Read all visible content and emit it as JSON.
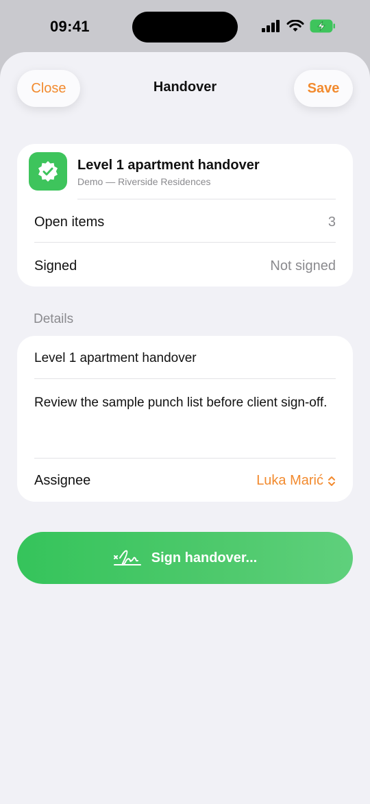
{
  "status_bar": {
    "time": "09:41",
    "icons": [
      "cellular-signal-icon",
      "wifi-icon",
      "battery-charging-icon"
    ]
  },
  "nav": {
    "close_label": "Close",
    "title": "Handover",
    "save_label": "Save"
  },
  "summary": {
    "icon": "checkmark-seal-icon",
    "title": "Level 1 apartment handover",
    "subtitle": "Demo — Riverside Residences",
    "rows": [
      {
        "label": "Open items",
        "value": "3"
      },
      {
        "label": "Signed",
        "value": "Not signed"
      }
    ]
  },
  "details": {
    "header": "Details",
    "title_value": "Level 1 apartment handover",
    "notes_value": "Review the sample punch list before client sign-off.",
    "assignee_label": "Assignee",
    "assignee_value": "Luka Marić"
  },
  "sign": {
    "icon": "signature-icon",
    "label": "Sign handover..."
  },
  "colors": {
    "accent": "#f28a2e",
    "success": "#3ec45c",
    "background": "#f1f1f6"
  }
}
